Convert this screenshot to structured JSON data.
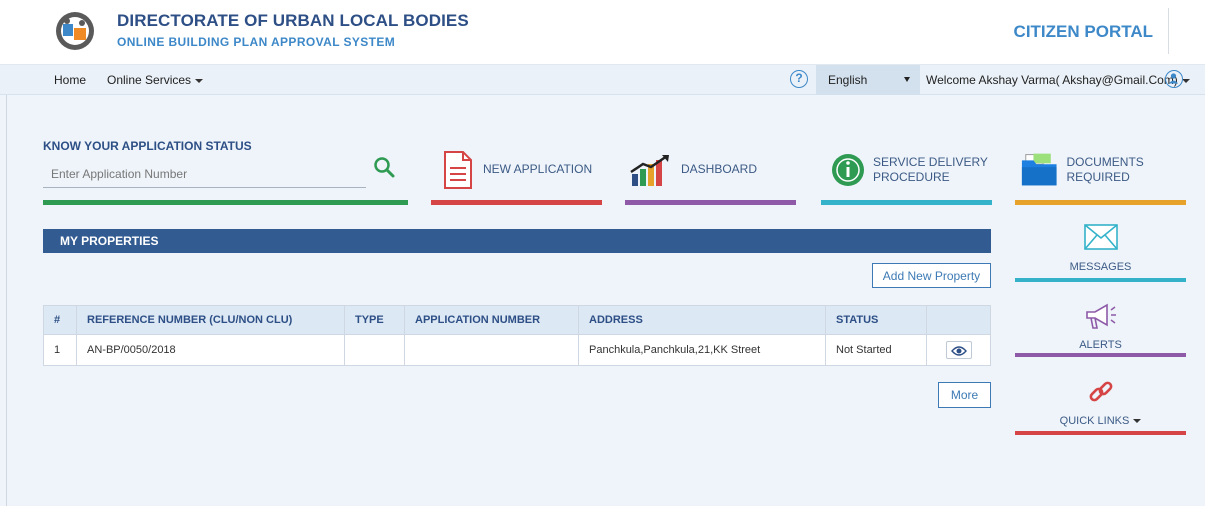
{
  "header": {
    "org_title": "DIRECTORATE OF URBAN LOCAL BODIES",
    "org_subtitle": "ONLINE BUILDING PLAN APPROVAL SYSTEM",
    "portal_name": "CITIZEN PORTAL"
  },
  "nav": {
    "home": "Home",
    "online_services": "Online Services",
    "help_symbol": "?",
    "language": "English",
    "welcome": "Welcome Akshay Varma( Akshay@Gmail.Com)"
  },
  "status_search": {
    "title": "KNOW YOUR APPLICATION STATUS",
    "placeholder": "Enter Application Number"
  },
  "tiles": {
    "new_application": "NEW APPLICATION",
    "dashboard": "DASHBOARD",
    "service_delivery_line1": "SERVICE DELIVERY",
    "service_delivery_line2": "PROCEDURE",
    "documents_required": "DOCUMENTS REQUIRED"
  },
  "properties": {
    "title": "MY PROPERTIES",
    "add_button": "Add New Property",
    "more_button": "More",
    "columns": [
      "#",
      "REFERENCE NUMBER (CLU/NON CLU)",
      "TYPE",
      "APPLICATION NUMBER",
      "ADDRESS",
      "STATUS",
      ""
    ],
    "rows": [
      {
        "index": "1",
        "reference": "AN-BP/0050/2018",
        "type": "",
        "application_number": "",
        "address": "Panchkula,Panchkula,21,KK Street",
        "status": "Not Started"
      }
    ]
  },
  "sidebar": {
    "messages": "MESSAGES",
    "alerts": "ALERTS",
    "quick_links": "QUICK LINKS"
  },
  "colors": {
    "green": "#2e9a52",
    "red": "#d64545",
    "purple": "#8e5aa8",
    "teal": "#33b2c9",
    "orange": "#e6a22a",
    "navy": "#325b91"
  }
}
